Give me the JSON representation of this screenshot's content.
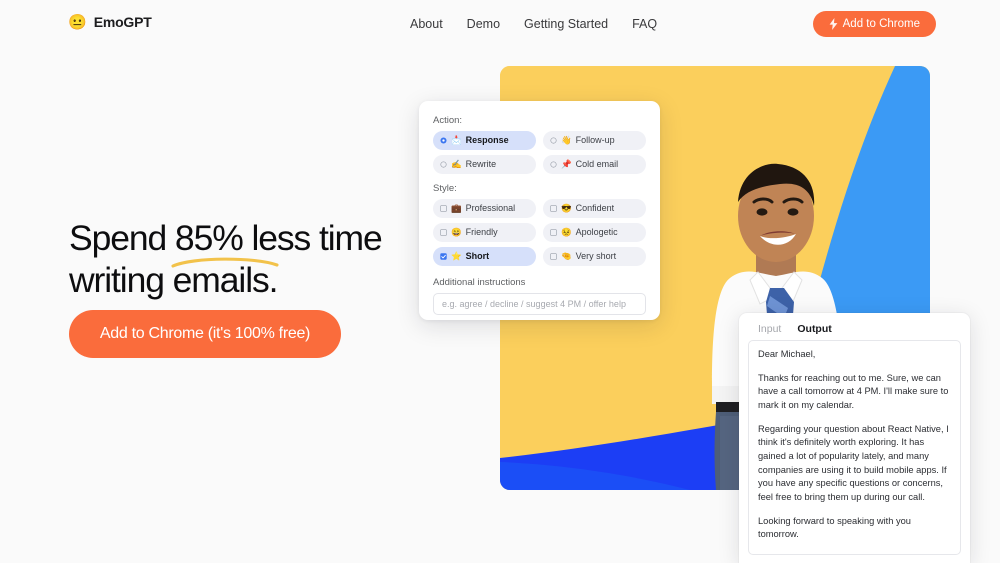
{
  "nav": {
    "brand_emoji": "😐",
    "brand_name": "EmoGPT",
    "links": [
      {
        "label": "About"
      },
      {
        "label": "Demo"
      },
      {
        "label": "Getting Started"
      },
      {
        "label": "FAQ"
      }
    ],
    "cta_label": "Add to Chrome",
    "cta_icon": "lightning-bolt-icon"
  },
  "hero": {
    "headline_pre": "Spend ",
    "headline_highlight": "85%",
    "headline_post": " less time",
    "headline_line2": "writing emails.",
    "underline_color": "#F2C24A",
    "cta_label": "Add to Chrome (it's 100% free)",
    "cta_color": "#FA6C3C"
  },
  "image": {
    "bg_yellow": "#FBCF5C",
    "accent_blue_light": "#3B9AF5",
    "accent_blue_deep": "#1C3EF5",
    "alt": "smiling man in white shirt and striped tie giving thumbs up"
  },
  "options_card": {
    "action_label": "Action:",
    "actions": [
      {
        "emoji": "📩",
        "label": "Response",
        "selected": true,
        "control": "radio"
      },
      {
        "emoji": "👋",
        "label": "Follow-up",
        "selected": false,
        "control": "radio"
      },
      {
        "emoji": "✍️",
        "label": "Rewrite",
        "selected": false,
        "control": "radio"
      },
      {
        "emoji": "📌",
        "label": "Cold email",
        "selected": false,
        "control": "radio"
      }
    ],
    "style_label": "Style:",
    "styles": [
      {
        "emoji": "💼",
        "label": "Professional",
        "selected": false,
        "control": "checkbox"
      },
      {
        "emoji": "😎",
        "label": "Confident",
        "selected": false,
        "control": "checkbox"
      },
      {
        "emoji": "😄",
        "label": "Friendly",
        "selected": false,
        "control": "checkbox"
      },
      {
        "emoji": "😣",
        "label": "Apologetic",
        "selected": false,
        "control": "checkbox"
      },
      {
        "emoji": "⭐",
        "label": "Short",
        "selected": true,
        "control": "checkbox"
      },
      {
        "emoji": "🤏",
        "label": "Very short",
        "selected": false,
        "control": "checkbox"
      }
    ],
    "additional_label": "Additional instructions",
    "additional_placeholder": "e.g. agree / decline / suggest 4 PM / offer help",
    "additional_value": "",
    "selected_bg": "#D6E0FA"
  },
  "output_panel": {
    "tabs": [
      {
        "label": "Input",
        "active": false
      },
      {
        "label": "Output",
        "active": true
      }
    ],
    "paragraphs": [
      "Dear Michael,",
      "Thanks for reaching out to me. Sure, we can have a call tomorrow at 4 PM. I'll make sure to mark it on my calendar.",
      "Regarding your question about React Native, I think it's definitely worth exploring. It has gained a lot of popularity lately, and many companies are using it to build mobile apps. If you have any specific questions or concerns, feel free to bring them up during our call.",
      "Looking forward to speaking with you tomorrow."
    ]
  }
}
